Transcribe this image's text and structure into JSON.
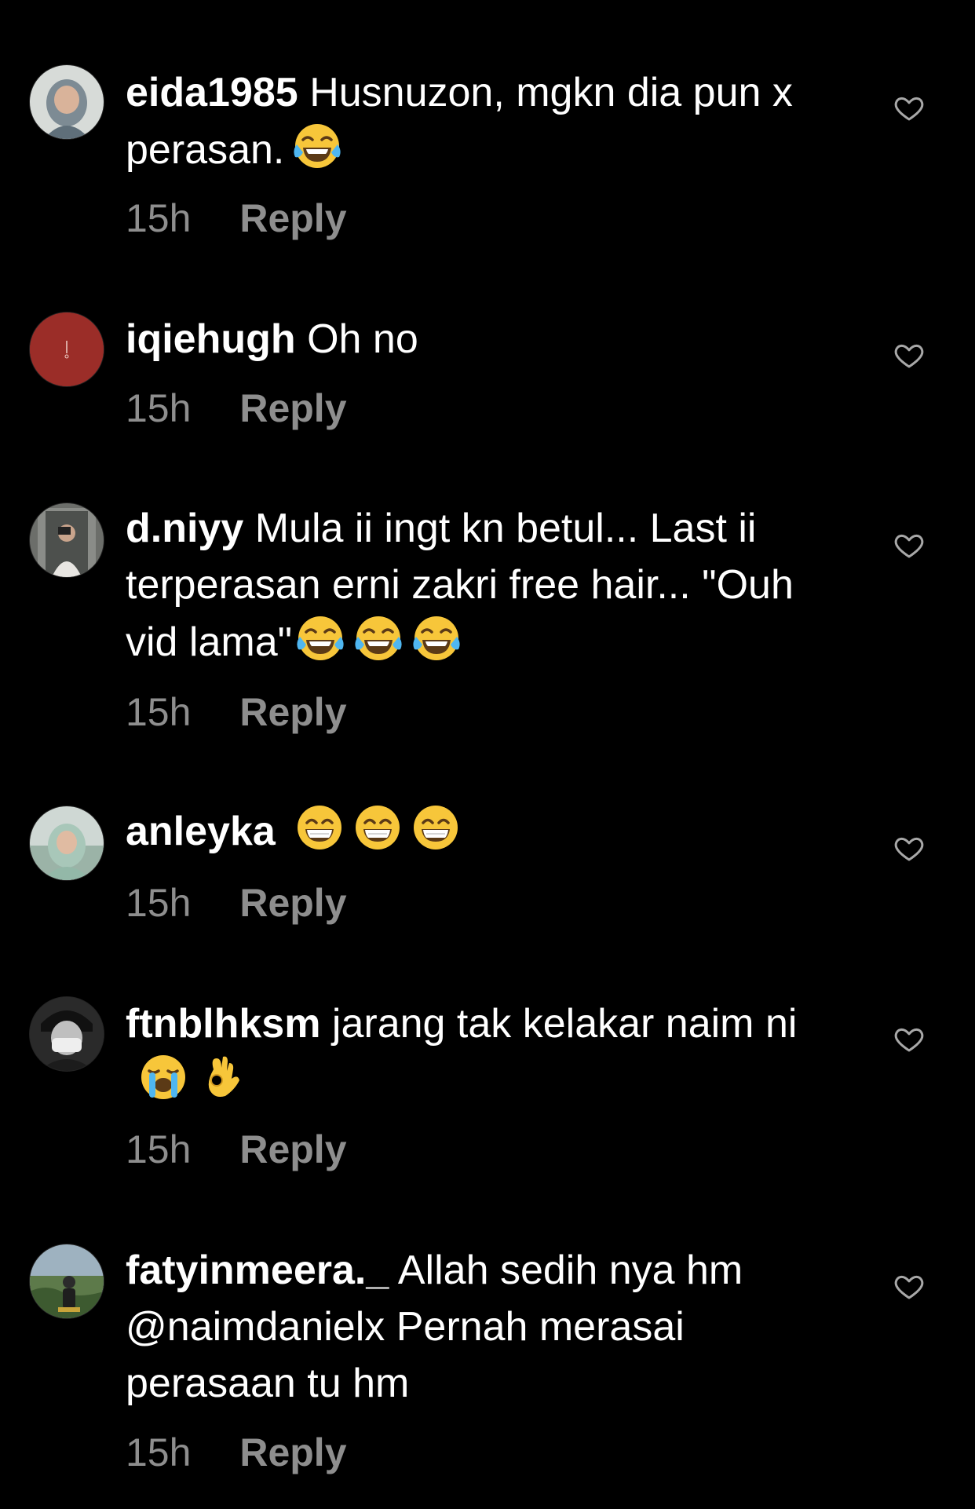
{
  "colors": {
    "background": "#000000",
    "text": "#ffffff",
    "muted": "#8e8e8e"
  },
  "comments": [
    {
      "username": "eida1985",
      "text": "Husnuzon, mgkn dia pun x perasan.",
      "emojis": [
        "face-with-tears-of-joy"
      ],
      "time": "15h",
      "reply": "Reply",
      "like_icon": "heart-outline-icon"
    },
    {
      "username": "iqiehugh",
      "text": "Oh no",
      "emojis": [],
      "time": "15h",
      "reply": "Reply",
      "like_icon": "heart-outline-icon"
    },
    {
      "username": "d.niyy",
      "text": "Mula ii ingt kn betul... Last ii terperasan erni zakri free hair... \"Ouh vid lama\"",
      "emojis": [
        "face-with-tears-of-joy",
        "face-with-tears-of-joy",
        "face-with-tears-of-joy"
      ],
      "time": "15h",
      "reply": "Reply",
      "like_icon": "heart-outline-icon"
    },
    {
      "username": "anleyka",
      "text": "",
      "emojis": [
        "grinning-face-with-smiling-eyes",
        "grinning-face-with-smiling-eyes",
        "grinning-face-with-smiling-eyes"
      ],
      "time": "15h",
      "reply": "Reply",
      "like_icon": "heart-outline-icon"
    },
    {
      "username": "ftnblhksm",
      "text": "jarang tak kelakar naim ni",
      "emojis": [
        "loudly-crying-face",
        "ok-hand"
      ],
      "time": "15h",
      "reply": "Reply",
      "like_icon": "heart-outline-icon"
    },
    {
      "username": "fatyinmeera._",
      "text": "Allah sedih nya hm @naimdanielx Pernah merasai perasaan tu hm",
      "emojis": [],
      "time": "15h",
      "reply": "Reply",
      "like_icon": "heart-outline-icon"
    }
  ]
}
